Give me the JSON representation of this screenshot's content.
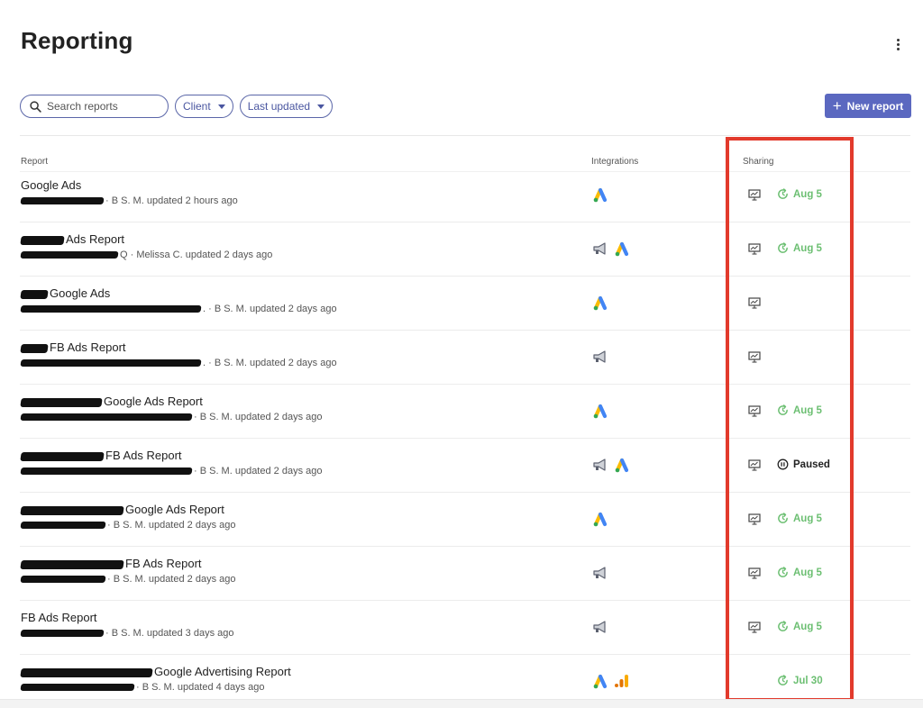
{
  "page": {
    "title": "Reporting"
  },
  "toolbar": {
    "search_placeholder": "Search reports",
    "client_filter": "Client",
    "last_updated_filter": "Last updated",
    "new_report_label": "New report"
  },
  "table": {
    "columns": {
      "report": "Report",
      "integrations": "Integrations",
      "sharing": "Sharing"
    },
    "rows": [
      {
        "name": "Google Ads",
        "name_redact_width": 0,
        "meta_redact_width": 92,
        "meta": "· B S. M. updated 2 hours ago",
        "integrations": [
          "google-ads"
        ],
        "share_icon": true,
        "schedule": {
          "status": "active",
          "label": "Aug 5"
        }
      },
      {
        "name": "Ads Report",
        "name_redact_width": 48,
        "meta_redact_width": 108,
        "meta": "Q · Melissa C. updated 2 days ago",
        "integrations": [
          "megaphone",
          "google-ads"
        ],
        "share_icon": true,
        "schedule": {
          "status": "active",
          "label": "Aug 5"
        }
      },
      {
        "name": "Google Ads",
        "name_redact_width": 30,
        "meta_redact_width": 200,
        "meta": ". · B S. M. updated 2 days ago",
        "integrations": [
          "google-ads"
        ],
        "share_icon": true,
        "schedule": null
      },
      {
        "name": "FB Ads Report",
        "name_redact_width": 30,
        "meta_redact_width": 200,
        "meta": ". · B S. M. updated 2 days ago",
        "integrations": [
          "megaphone"
        ],
        "share_icon": true,
        "schedule": null
      },
      {
        "name": "Google Ads Report",
        "name_redact_width": 90,
        "meta_redact_width": 190,
        "meta": "· B S. M. updated 2 days ago",
        "integrations": [
          "google-ads"
        ],
        "share_icon": true,
        "schedule": {
          "status": "active",
          "label": "Aug 5"
        }
      },
      {
        "name": "FB Ads Report",
        "name_redact_width": 92,
        "meta_redact_width": 190,
        "meta": "· B S. M. updated 2 days ago",
        "integrations": [
          "megaphone",
          "google-ads"
        ],
        "share_icon": true,
        "schedule": {
          "status": "paused",
          "label": "Paused"
        }
      },
      {
        "name": "Google Ads Report",
        "name_redact_width": 114,
        "meta_redact_width": 94,
        "meta": "· B S. M. updated 2 days ago",
        "integrations": [
          "google-ads"
        ],
        "share_icon": true,
        "schedule": {
          "status": "active",
          "label": "Aug 5"
        }
      },
      {
        "name": "FB Ads Report",
        "name_redact_width": 114,
        "meta_redact_width": 94,
        "meta": "· B S. M. updated 2 days ago",
        "integrations": [
          "megaphone"
        ],
        "share_icon": true,
        "schedule": {
          "status": "active",
          "label": "Aug 5"
        }
      },
      {
        "name": "FB Ads Report",
        "name_redact_width": 0,
        "meta_redact_width": 92,
        "meta": "· B S. M. updated 3 days ago",
        "integrations": [
          "megaphone"
        ],
        "share_icon": true,
        "schedule": {
          "status": "active",
          "label": "Aug 5"
        }
      },
      {
        "name": "Google Advertising Report",
        "name_redact_width": 146,
        "meta_redact_width": 126,
        "meta": "· B S. M. updated 4 days ago",
        "integrations": [
          "google-ads",
          "analytics"
        ],
        "share_icon": false,
        "schedule": {
          "status": "active",
          "label": "Jul 30"
        }
      }
    ]
  },
  "colors": {
    "accent": "#5b68c0",
    "active_schedule": "#6cbf72",
    "highlight": "#e23a2c"
  },
  "icons": {
    "menu": "kebab-icon",
    "search": "search-icon",
    "share": "presentation-screen-icon",
    "schedule_active": "refresh-clock-icon",
    "schedule_paused": "pause-circle-icon"
  }
}
